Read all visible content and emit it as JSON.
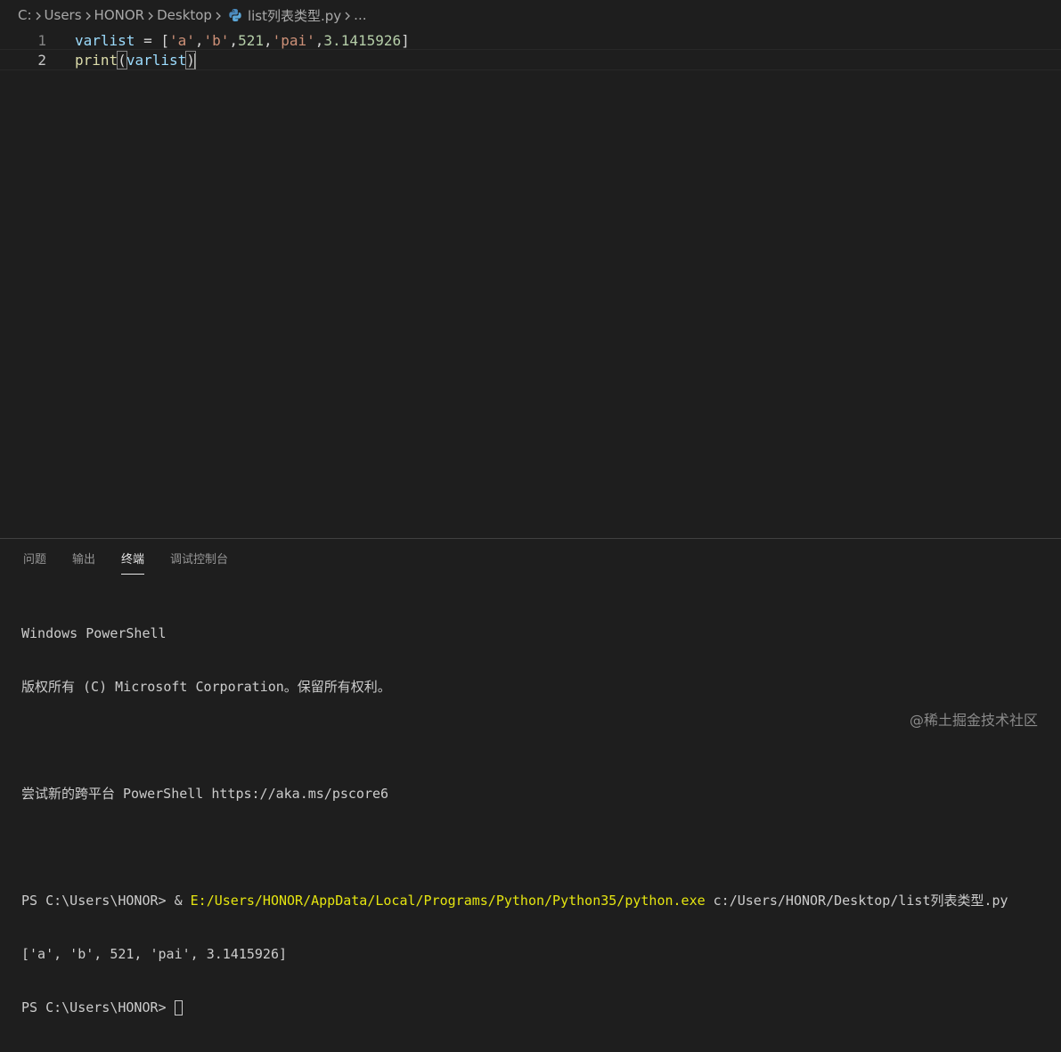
{
  "breadcrumb": {
    "items": [
      "C:",
      "Users",
      "HONOR",
      "Desktop",
      "list列表类型.py",
      "..."
    ],
    "file_icon": "python-icon"
  },
  "editor": {
    "lines": [
      {
        "number": "1",
        "tokens": [
          "varlist",
          " = [",
          "'a'",
          ",",
          "'b'",
          ",",
          "521",
          ",",
          "'pai'",
          ",",
          "3.1415926",
          "]"
        ]
      },
      {
        "number": "2",
        "tokens": [
          "print",
          "(",
          "varlist",
          ")"
        ]
      }
    ]
  },
  "panel": {
    "tabs": [
      "问题",
      "输出",
      "终端",
      "调试控制台"
    ],
    "active_tab": "终端"
  },
  "terminal": {
    "line1": "Windows PowerShell",
    "line2": "版权所有 (C) Microsoft Corporation。保留所有权利。",
    "line3": "尝试新的跨平台 PowerShell https://aka.ms/pscore6",
    "prompt1": "PS C:\\Users\\HONOR> ",
    "amp": "& ",
    "exe": "E:/Users/HONOR/AppData/Local/Programs/Python/Python35/python.exe",
    "script": " c:/Users/HONOR/Desktop/list列表类型.py",
    "output": "['a', 'b', 521, 'pai', 3.1415926]",
    "prompt2": "PS C:\\Users\\HONOR> "
  },
  "watermark": "@稀土掘金技术社区",
  "colors": {
    "background": "#1e1e1e",
    "variable": "#9cdcfe",
    "string": "#ce9178",
    "number": "#b5cea8",
    "function": "#dcdcaa",
    "terminal_path": "#e5e510"
  }
}
